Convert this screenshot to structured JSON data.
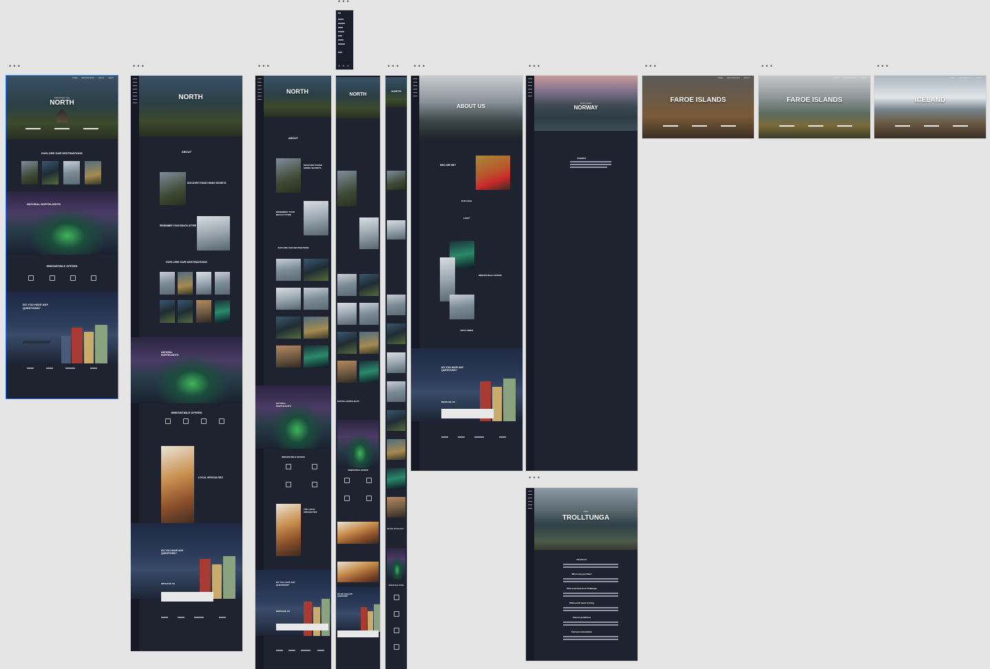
{
  "frames": {
    "north_home": {
      "hero_kicker": "DISCOVER THE",
      "hero_title": "NORTH",
      "explore_title": "EXPLORE OUR DESTINATIONS",
      "lights_title": "NATURAL NORTHLIGHTS",
      "offers_title": "IRRESISTIBLE OFFERS",
      "questions_title": "DO YOU HAVE ANY QUESTIONS?"
    },
    "north_v2": {
      "hero_title": "NORTH",
      "about_title": "ABOUT",
      "block1_title": "DISCOVER THOSE HIDING SECRETS",
      "block2_title": "REMEMBER YOUR BEACH ATTIRE",
      "explore_title": "EXPLORE OUR DESTINATIONS",
      "lights_title": "NATURAL NORTHLIGHTS",
      "offers_title": "IRRESISTIBLE OFFERS",
      "local_title": "LOCAL SPECIALTIES",
      "questions_title": "DO YOU HAVE ANY QUESTIONS?",
      "message_label": "MESSAGE US"
    },
    "north_v3": {
      "hero_title": "NORTH",
      "about_title": "ABOUT",
      "block1_title": "DISCOVER THOSE HIDING SECRETS",
      "block2_title": "REMEMBER YOUR BEACH ATTIRE",
      "explore_title": "EXPLORE OUR DESTINATIONS",
      "lights_title": "NATURAL NORTHLIGHTS",
      "offers_title": "IRRESISTIBLE OFFERS",
      "local_title": "THE LOCAL SPECIALTIES",
      "questions_title": "DO YOU HAVE ANY QUESTIONS?",
      "message_label": "MESSAGE US"
    },
    "north_tablet": {
      "hero_title": "NORTH",
      "lights_title": "NATURAL NORTHLIGHTS",
      "offers_title": "IRRESISTIBLE OFFERS",
      "questions_title": "DO YOU HAVE ANY QUESTIONS?"
    },
    "north_mobile": {
      "hero_title": "NORTH",
      "lights_title": "NATURAL NORTHLIGHTS",
      "offers_title": "IRRESISTIBLE OFFERS"
    },
    "about_us": {
      "hero_title": "ABOUT US",
      "who_title": "WHO ARE WE?",
      "goal_title": "OUR GOAL",
      "how_title": "HOW?",
      "offers_title": "IRRESISTIBLE OFFERS",
      "disclaimer_title": "DISCLAIMER",
      "questions_title": "DO YOU HAVE ANY QUESTIONS?",
      "message_label": "MESSAGE US"
    },
    "norway": {
      "hero_kicker": "DISCOVER",
      "hero_title": "NORWAY",
      "section_title": "NORWAY"
    },
    "faroe_1": {
      "hero_title": "FAROE ISLANDS"
    },
    "faroe_2": {
      "hero_title": "FAROE ISLANDS"
    },
    "iceland": {
      "hero_title": "ICELAND"
    },
    "trolltunga": {
      "hero_kicker": "HIKE",
      "hero_title": "TROLLTUNGA",
      "sections": [
        "Directions",
        "When can you hike?",
        "Risk assessment of Trolltunga",
        "What you'll need to bring",
        "Season guidelines",
        "Find accommodation"
      ]
    }
  },
  "colors": {
    "canvas": "#e5e5e5",
    "frame_bg": "#1f2330",
    "selection": "#2d7ff9"
  }
}
